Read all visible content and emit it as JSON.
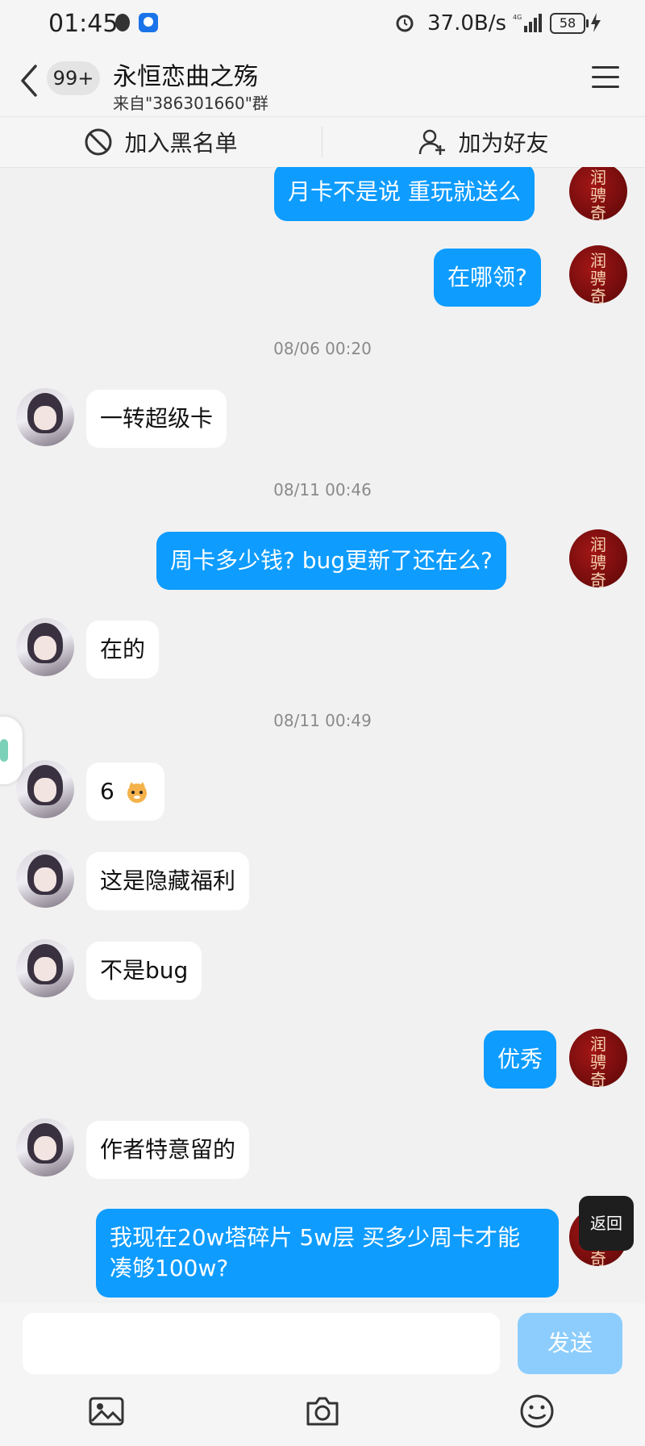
{
  "status_bar": {
    "time": "01:45",
    "net_rate": "37.0B/s",
    "battery": "58"
  },
  "header": {
    "unread": "99+",
    "title": "永恒恋曲之殇",
    "subtitle": "来自\"386301660\"群"
  },
  "actions": {
    "blacklist": "加入黑名单",
    "add_friend": "加为好友"
  },
  "messages": {
    "m1": "月卡不是说  重玩就送么",
    "m2": "在哪领?",
    "t1": "08/06 00:20",
    "m3": "一转超级卡",
    "t2": "08/11 00:46",
    "m4": "周卡多少钱?   bug更新了还在么?",
    "m5": "在的",
    "t3": "08/11 00:49",
    "m6": "6",
    "m7": "这是隐藏福利",
    "m8": "不是bug",
    "m9": "优秀",
    "m10": "作者特意留的",
    "m11_line1": "我现在20w塔碎片 5w层 买多少周卡才能",
    "m11_line2": "凑够100w?"
  },
  "my_avatar_text": "润\n骋\n奇",
  "floating": {
    "return": "返回"
  },
  "input": {
    "send": "发送"
  }
}
